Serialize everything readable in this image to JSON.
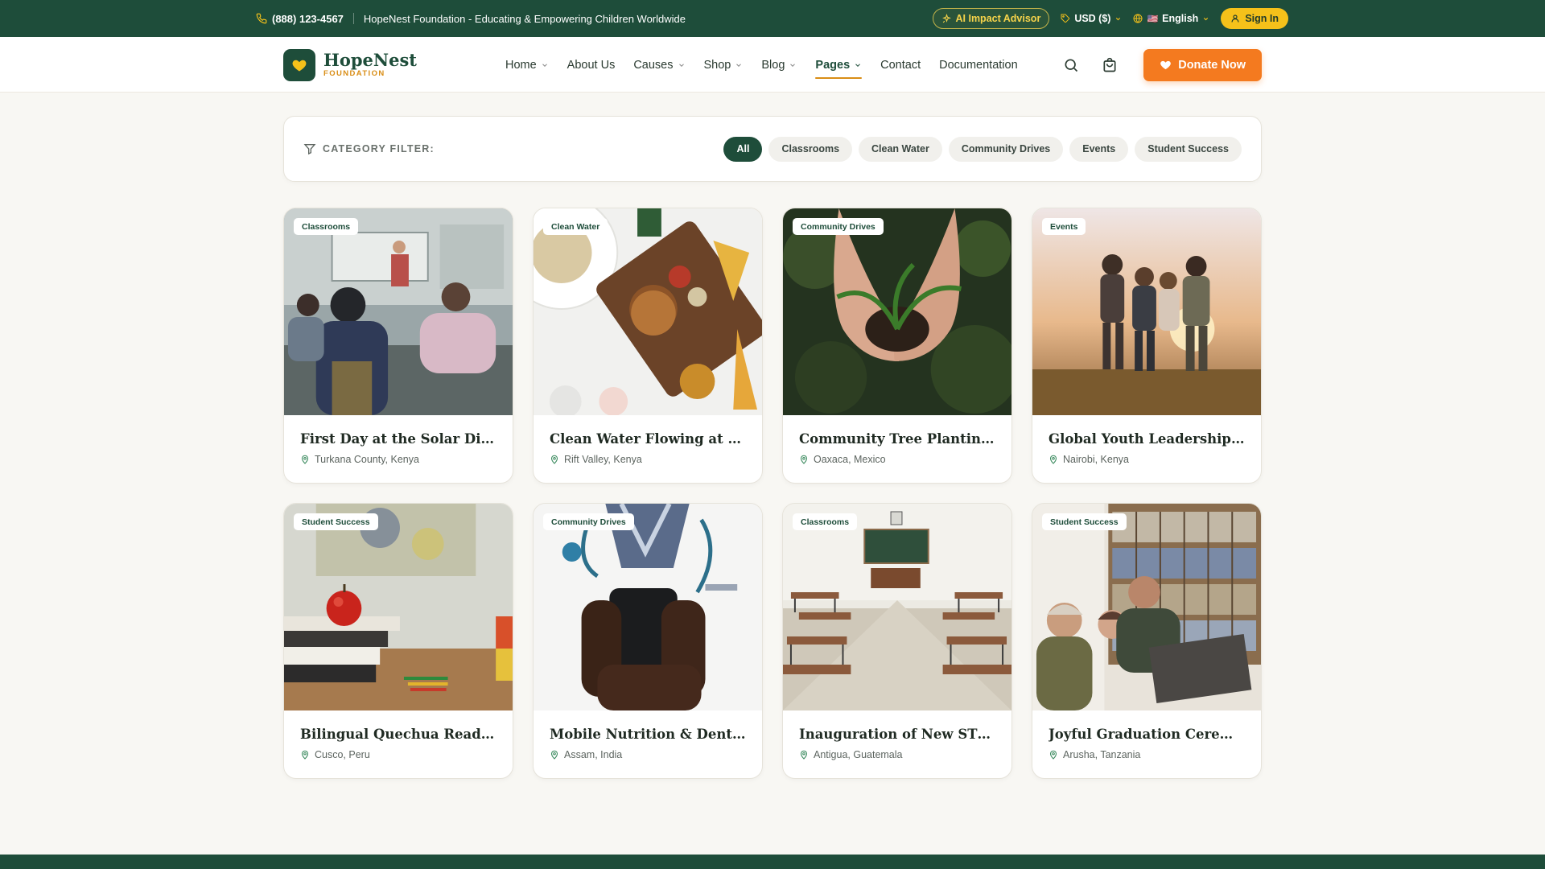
{
  "topbar": {
    "phone": "(888) 123-4567",
    "tagline": "HopeNest Foundation - Educating & Empowering Children Worldwide",
    "ai_label": "AI Impact Advisor",
    "currency": "USD ($)",
    "language": "English",
    "language_flag": "🇺🇸",
    "signin": "Sign In"
  },
  "brand": {
    "name": "HopeNest",
    "sub": "FOUNDATION",
    "color": "#1e4d3a",
    "accent": "#d98d15"
  },
  "nav": {
    "items": [
      {
        "label": "Home",
        "dropdown": true
      },
      {
        "label": "About Us",
        "dropdown": false
      },
      {
        "label": "Causes",
        "dropdown": true
      },
      {
        "label": "Shop",
        "dropdown": true
      },
      {
        "label": "Blog",
        "dropdown": true
      },
      {
        "label": "Pages",
        "dropdown": true,
        "active": true
      },
      {
        "label": "Contact",
        "dropdown": false
      },
      {
        "label": "Documentation",
        "dropdown": false
      }
    ],
    "donate": "Donate Now",
    "donate_color": "#f47a1f"
  },
  "filter": {
    "label": "CATEGORY FILTER:",
    "chips": [
      "All",
      "Classrooms",
      "Clean Water",
      "Community Drives",
      "Events",
      "Student Success"
    ],
    "active": "All"
  },
  "cards": [
    {
      "category": "Classrooms",
      "title": "First Day at the Solar Digita...",
      "location": "Turkana County, Kenya"
    },
    {
      "category": "Clean Water",
      "title": "Clean Water Flowing at St....",
      "location": "Rift Valley, Kenya"
    },
    {
      "category": "Community Drives",
      "title": "Community Tree Planting ...",
      "location": "Oaxaca, Mexico"
    },
    {
      "category": "Events",
      "title": "Global Youth Leadership...",
      "location": "Nairobi, Kenya"
    },
    {
      "category": "Student Success",
      "title": "Bilingual Quechua Reading...",
      "location": "Cusco, Peru"
    },
    {
      "category": "Community Drives",
      "title": "Mobile Nutrition & Dental...",
      "location": "Assam, India"
    },
    {
      "category": "Classrooms",
      "title": "Inauguration of New STEM...",
      "location": "Antigua, Guatemala"
    },
    {
      "category": "Student Success",
      "title": "Joyful Graduation Ceremony",
      "location": "Arusha, Tanzania"
    }
  ]
}
